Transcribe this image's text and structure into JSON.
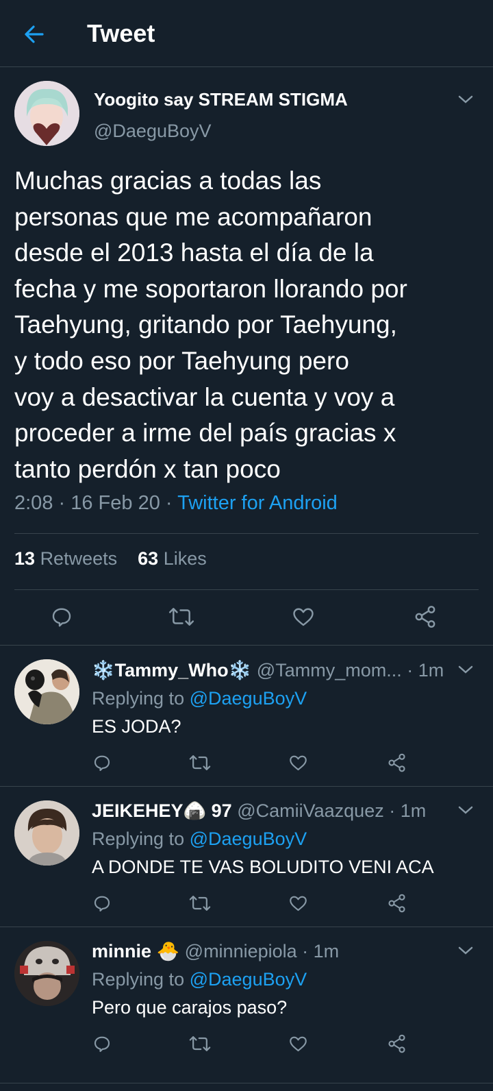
{
  "header": {
    "title": "Tweet"
  },
  "tweet": {
    "display_name": "Yoogito say STREAM STIGMA",
    "handle": "@DaeguBoyV",
    "text": "Muchas gracias a todas las\npersonas que me acompañaron\ndesde el 2013 hasta el día de la\nfecha y me soportaron llorando por\nTaehyung, gritando por Taehyung,\ny todo eso por Taehyung pero\nvoy a desactivar la cuenta y voy a\nproceder a irme del país gracias x\ntanto perdón x tan poco",
    "time": "2:08",
    "sep1": " · ",
    "date": "16 Feb 20",
    "sep2": " · ",
    "source": "Twitter for Android",
    "retweets_count": "13",
    "retweets_label": "Retweets",
    "likes_count": "63",
    "likes_label": "Likes"
  },
  "replies": [
    {
      "name": "❄️Tammy_Who❄️",
      "handle": "@Tammy_mom...",
      "time": "· 1m",
      "replying_label": "Replying to",
      "mention": "@DaeguBoyV",
      "text": "ES JODA?"
    },
    {
      "name": "JEIKEHEY🍙 97",
      "handle": "@CamiiVaazquez",
      "time": "· 1m",
      "replying_label": "Replying to",
      "mention": "@DaeguBoyV",
      "text": "A DONDE TE VAS BOLUDITO VENI ACA"
    },
    {
      "name": "minnie 🐣",
      "handle": "@minniepiola",
      "time": "· 1m",
      "replying_label": "Replying to",
      "mention": "@DaeguBoyV",
      "text": "Pero que carajos paso?"
    }
  ],
  "colors": {
    "background": "#15202b",
    "accent": "#1da1f2",
    "secondary_text": "#8899a6",
    "divider": "#38444d"
  },
  "icons": [
    "back-arrow-icon",
    "chevron-down-icon",
    "reply-icon",
    "retweet-icon",
    "like-icon",
    "share-icon"
  ]
}
